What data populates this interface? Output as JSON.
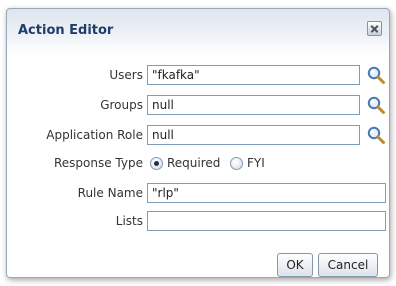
{
  "dialog": {
    "title": "Action Editor",
    "close_icon": "close-x-icon"
  },
  "form": {
    "users": {
      "label": "Users",
      "value": "\"fkafka\"",
      "icon": "search-icon"
    },
    "groups": {
      "label": "Groups",
      "value": "null",
      "icon": "search-icon"
    },
    "application_role": {
      "label": "Application Role",
      "value": "null",
      "icon": "search-icon"
    },
    "response_type": {
      "label": "Response Type",
      "options": [
        {
          "label": "Required",
          "selected": true
        },
        {
          "label": "FYI",
          "selected": false
        }
      ]
    },
    "rule_name": {
      "label": "Rule Name",
      "value": "\"rlp\""
    },
    "lists": {
      "label": "Lists",
      "value": ""
    }
  },
  "buttons": {
    "ok_label": "OK",
    "cancel_label": "Cancel"
  },
  "colors": {
    "title": "#1e3d6b",
    "field_border": "#7f9db9",
    "search_icon": "#4a78b0"
  }
}
